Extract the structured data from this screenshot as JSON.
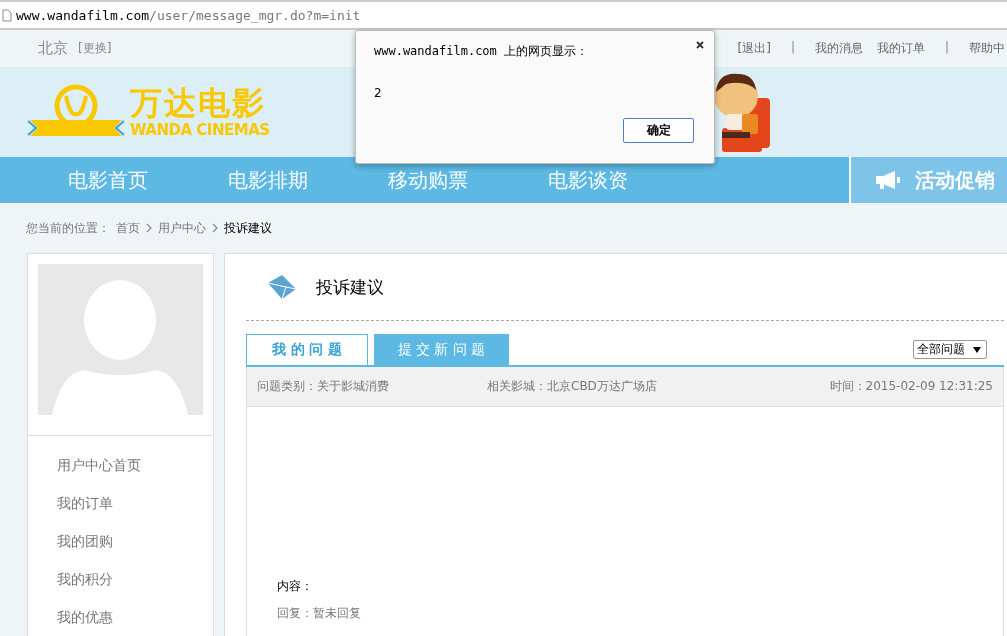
{
  "address_bar": {
    "host": "www.wandafilm.com",
    "path": "/user/message_mgr.do?m=init"
  },
  "top_bar": {
    "city": "北京",
    "change_city": "[更换]",
    "links": [
      {
        "kind": "link",
        "text": "[退出]"
      },
      {
        "kind": "separator",
        "text": "|"
      },
      {
        "kind": "link",
        "text": "我的消息"
      },
      {
        "kind": "link",
        "text": "我的订单"
      },
      {
        "kind": "separator",
        "text": "|"
      },
      {
        "kind": "link",
        "text": "帮助中"
      }
    ]
  },
  "logo": {
    "title": "万达电影",
    "subtitle": "WANDA CINEMAS"
  },
  "nav": {
    "items": [
      "电影首页",
      "电影排期",
      "移动购票",
      "电影谈资"
    ],
    "promo": "活动促销"
  },
  "breadcrumb": {
    "prefix": "您当前的位置：",
    "items": [
      {
        "text": "首页",
        "current": false
      },
      {
        "text": "用户中心",
        "current": false
      },
      {
        "text": "投诉建议",
        "current": true
      }
    ]
  },
  "sidebar": {
    "items": [
      "用户中心首页",
      "我的订单",
      "我的团购",
      "我的积分",
      "我的优惠"
    ]
  },
  "panel": {
    "title": "投诉建议",
    "tabs": [
      {
        "label": "我 的 问 题",
        "selected": true
      },
      {
        "label": "提 交 新 问 题",
        "selected": false
      }
    ],
    "filter": "全部问题",
    "question": {
      "category": "问题类别：关于影城消费",
      "cinema": "相关影城：北京CBD万达广场店",
      "time": "时间：2015-02-09 12:31:25",
      "content_label": "内容：",
      "reply": "回复：暂未回复"
    }
  },
  "dialog": {
    "title": "www.wandafilm.com 上的网页显示：",
    "message": "2",
    "ok_button": "确定"
  }
}
